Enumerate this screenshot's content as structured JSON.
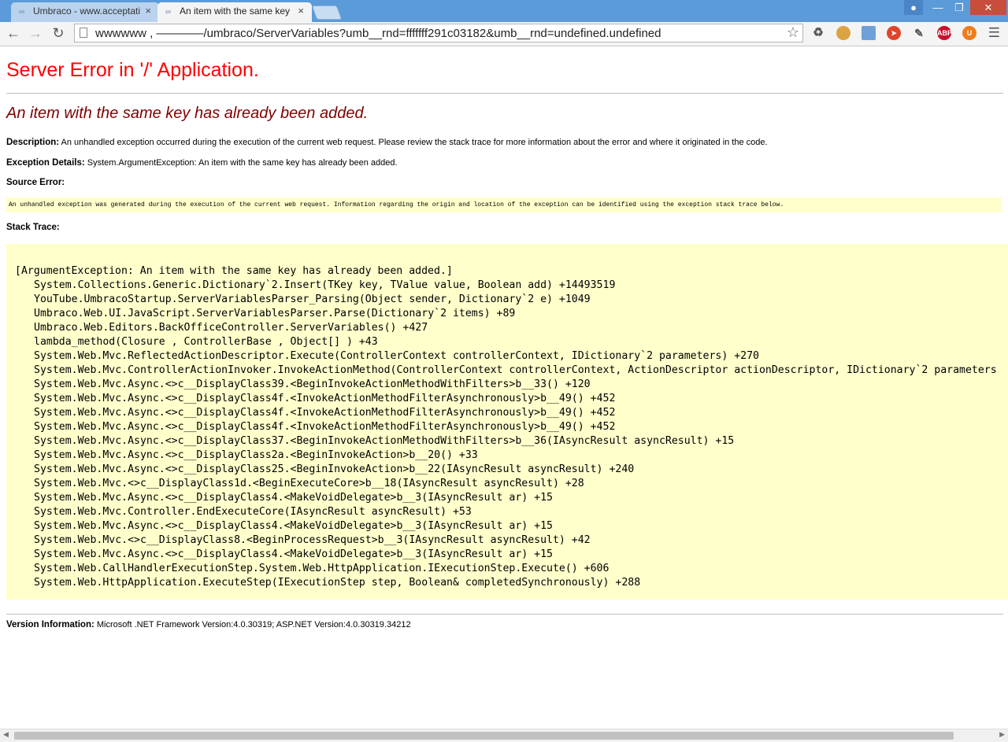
{
  "browser": {
    "tabs": [
      {
        "title": "Umbraco - www.acceptati",
        "favicon": "umbraco-icon",
        "active": false
      },
      {
        "title": "An item with the same key",
        "favicon": "umbraco-icon",
        "active": true
      }
    ],
    "url": "wwwwww                     , ————/umbraco/ServerVariables?umb__rnd=fffffff291c03182&umb__rnd=undefined.undefined",
    "extensions": [
      "recycle-icon",
      "cookie-icon",
      "folder-icon",
      "lastpass-icon",
      "pen-icon",
      "adblock-plus-icon",
      "ublock-icon"
    ],
    "abp_label": "ABP",
    "colors": {
      "frame": "#5b9bd9",
      "toolbar": "#f4f4f4"
    }
  },
  "page": {
    "title": "Server Error in '/' Application.",
    "error_message": "An item with the same key has already been added.",
    "description_label": "Description:",
    "description_text": "An unhandled exception occurred during the execution of the current web request. Please review the stack trace for more information about the error and where it originated in the code.",
    "exception_label": "Exception Details:",
    "exception_text": "System.ArgumentException: An item with the same key has already been added.",
    "source_error_label": "Source Error:",
    "source_error_text": "An unhandled exception was generated during the execution of the current web request. Information regarding the origin and location of the exception can be identified using the exception stack trace below.",
    "stack_trace_label": "Stack Trace:",
    "stack_head": "[ArgumentException: An item with the same key has already been added.]",
    "stack_frames": [
      "System.Collections.Generic.Dictionary`2.Insert(TKey key, TValue value, Boolean add) +14493519",
      "YouTube.UmbracoStartup.ServerVariablesParser_Parsing(Object sender, Dictionary`2 e) +1049",
      "Umbraco.Web.UI.JavaScript.ServerVariablesParser.Parse(Dictionary`2 items) +89",
      "Umbraco.Web.Editors.BackOfficeController.ServerVariables() +427",
      "lambda_method(Closure , ControllerBase , Object[] ) +43",
      "System.Web.Mvc.ReflectedActionDescriptor.Execute(ControllerContext controllerContext, IDictionary`2 parameters) +270",
      "System.Web.Mvc.ControllerActionInvoker.InvokeActionMethod(ControllerContext controllerContext, ActionDescriptor actionDescriptor, IDictionary`2 parameters",
      "System.Web.Mvc.Async.<>c__DisplayClass39.<BeginInvokeActionMethodWithFilters>b__33() +120",
      "System.Web.Mvc.Async.<>c__DisplayClass4f.<InvokeActionMethodFilterAsynchronously>b__49() +452",
      "System.Web.Mvc.Async.<>c__DisplayClass4f.<InvokeActionMethodFilterAsynchronously>b__49() +452",
      "System.Web.Mvc.Async.<>c__DisplayClass4f.<InvokeActionMethodFilterAsynchronously>b__49() +452",
      "System.Web.Mvc.Async.<>c__DisplayClass37.<BeginInvokeActionMethodWithFilters>b__36(IAsyncResult asyncResult) +15",
      "System.Web.Mvc.Async.<>c__DisplayClass2a.<BeginInvokeAction>b__20() +33",
      "System.Web.Mvc.Async.<>c__DisplayClass25.<BeginInvokeAction>b__22(IAsyncResult asyncResult) +240",
      "System.Web.Mvc.<>c__DisplayClass1d.<BeginExecuteCore>b__18(IAsyncResult asyncResult) +28",
      "System.Web.Mvc.Async.<>c__DisplayClass4.<MakeVoidDelegate>b__3(IAsyncResult ar) +15",
      "System.Web.Mvc.Controller.EndExecuteCore(IAsyncResult asyncResult) +53",
      "System.Web.Mvc.Async.<>c__DisplayClass4.<MakeVoidDelegate>b__3(IAsyncResult ar) +15",
      "System.Web.Mvc.<>c__DisplayClass8.<BeginProcessRequest>b__3(IAsyncResult asyncResult) +42",
      "System.Web.Mvc.Async.<>c__DisplayClass4.<MakeVoidDelegate>b__3(IAsyncResult ar) +15",
      "System.Web.CallHandlerExecutionStep.System.Web.HttpApplication.IExecutionStep.Execute() +606",
      "System.Web.HttpApplication.ExecuteStep(IExecutionStep step, Boolean& completedSynchronously) +288"
    ],
    "version_label": "Version Information:",
    "version_text": "Microsoft .NET Framework Version:4.0.30319; ASP.NET Version:4.0.30319.34212",
    "colors": {
      "title": "#ff0000",
      "message": "#800000",
      "code_bg": "#ffffcc"
    }
  }
}
